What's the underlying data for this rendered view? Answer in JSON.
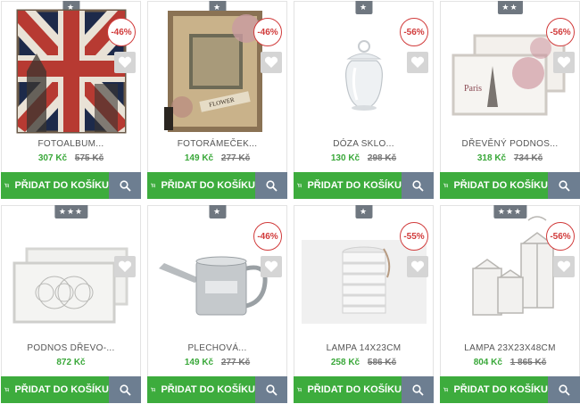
{
  "products": [
    {
      "name": "FOTOALBUM...",
      "price": "307 Kč",
      "old_price": "575 Kč",
      "discount": "-46%",
      "stars": "★",
      "cart_label": "PŘIDAT DO KOŠÍKU"
    },
    {
      "name": "FOTORÁMEČEK...",
      "price": "149 Kč",
      "old_price": "277 Kč",
      "discount": "-46%",
      "stars": "★",
      "cart_label": "PŘIDAT DO KOŠÍKU"
    },
    {
      "name": "DÓZA SKLO...",
      "price": "130 Kč",
      "old_price": "298 Kč",
      "discount": "-56%",
      "stars": "★",
      "cart_label": "PŘIDAT DO KOŠÍKU"
    },
    {
      "name": "DŘEVĚNÝ PODNOS...",
      "price": "318 Kč",
      "old_price": "734 Kč",
      "discount": "-56%",
      "stars": "★★",
      "cart_label": "PŘIDAT DO KOŠÍKU"
    },
    {
      "name": "PODNOS DŘEVO-...",
      "price": "872 Kč",
      "old_price": "",
      "discount": "",
      "stars": "★★★",
      "cart_label": "PŘIDAT DO KOŠÍKU"
    },
    {
      "name": "PLECHOVÁ...",
      "price": "149 Kč",
      "old_price": "277 Kč",
      "discount": "-46%",
      "stars": "★",
      "cart_label": "PŘIDAT DO KOŠÍKU"
    },
    {
      "name": "LAMPA 14X23CM",
      "price": "258 Kč",
      "old_price": "586 Kč",
      "discount": "-55%",
      "stars": "★",
      "cart_label": "PŘIDAT DO KOŠÍKU"
    },
    {
      "name": "LAMPA 23X23X48CM",
      "price": "804 Kč",
      "old_price": "1 865 Kč",
      "discount": "-56%",
      "stars": "★★★",
      "cart_label": "PŘIDAT DO KOŠÍKU"
    }
  ],
  "colors": {
    "cart_green": "#3dac3d",
    "price_green": "#3aa83a",
    "discount_red": "#d13b3b",
    "search_gray": "#6d7e91"
  },
  "icons": {
    "cart": "cart-icon",
    "search": "search-icon",
    "heart": "heart-icon",
    "star": "star-icon"
  }
}
